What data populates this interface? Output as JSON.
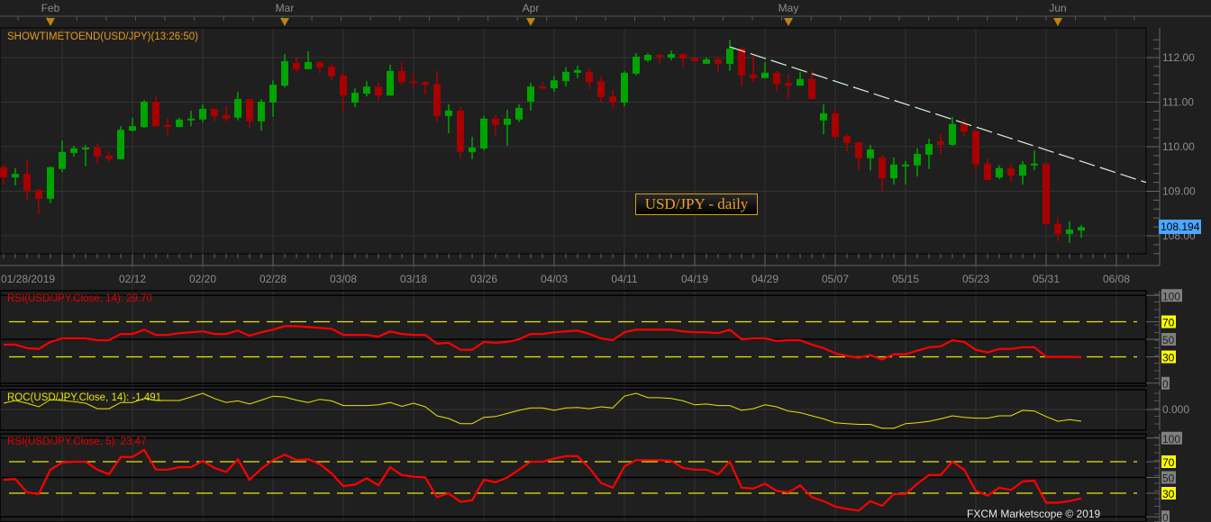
{
  "main": {
    "title": "SHOWTIMETOEND(USD/JPY)(13:26:50)",
    "legend_label": "USD/JPY - daily",
    "last_price": "108.194",
    "copyright": "FXCM Marketscope © 2019"
  },
  "colors": {
    "background": "#1f1f1f",
    "grid": "#333333",
    "bull": "#00a400",
    "bear": "#a80000",
    "title": "#e69a1c",
    "rsi": "#ff0000",
    "roc": "#e6e600",
    "level": "#e6e600",
    "trendline": "#d8f5d8",
    "last_price_bg": "#4da6ff"
  },
  "chart_data": {
    "type": "candlestick",
    "symbol": "USD/JPY",
    "month_markers": [
      "Feb",
      "Mar",
      "Apr",
      "May",
      "Jun"
    ],
    "x_tick_labels": [
      "01/28/2019",
      "02/12",
      "02/20",
      "02/28",
      "03/08",
      "03/18",
      "03/26",
      "04/03",
      "04/11",
      "04/19",
      "04/29",
      "05/07",
      "05/15",
      "05/23",
      "05/31",
      "06/08"
    ],
    "y_tick_labels": [
      "112.00",
      "111.00",
      "110.00",
      "109.00",
      "108.00"
    ],
    "ylim": [
      107.6,
      112.65
    ],
    "grid": true,
    "candles_columns": [
      "date",
      "open",
      "high",
      "low",
      "close"
    ],
    "candles": [
      [
        "01/28",
        109.54,
        109.58,
        109.15,
        109.31
      ],
      [
        "01/29",
        109.31,
        109.52,
        109.13,
        109.39
      ],
      [
        "01/30",
        109.39,
        109.72,
        108.81,
        109.01
      ],
      [
        "01/31",
        109.03,
        109.05,
        108.49,
        108.83
      ],
      [
        "02/01",
        108.83,
        109.56,
        108.73,
        109.54
      ],
      [
        "02/04",
        109.5,
        110.14,
        109.43,
        109.88
      ],
      [
        "02/05",
        109.86,
        110.02,
        109.78,
        109.96
      ],
      [
        "02/06",
        109.94,
        110.04,
        109.56,
        109.98
      ],
      [
        "02/07",
        109.98,
        110.08,
        109.62,
        109.78
      ],
      [
        "02/08",
        109.8,
        109.88,
        109.66,
        109.72
      ],
      [
        "02/11",
        109.72,
        110.46,
        109.72,
        110.38
      ],
      [
        "02/12",
        110.36,
        110.65,
        110.34,
        110.46
      ],
      [
        "02/13",
        110.44,
        111.05,
        110.42,
        111.01
      ],
      [
        "02/14",
        111.01,
        111.13,
        110.44,
        110.46
      ],
      [
        "02/15",
        110.49,
        110.65,
        110.26,
        110.44
      ],
      [
        "02/18",
        110.44,
        110.65,
        110.44,
        110.61
      ],
      [
        "02/19",
        110.59,
        110.81,
        110.46,
        110.63
      ],
      [
        "02/20",
        110.61,
        110.95,
        110.55,
        110.85
      ],
      [
        "02/21",
        110.85,
        110.85,
        110.57,
        110.69
      ],
      [
        "02/22",
        110.71,
        110.91,
        110.57,
        110.63
      ],
      [
        "02/25",
        110.65,
        111.23,
        110.59,
        111.07
      ],
      [
        "02/26",
        111.07,
        111.07,
        110.42,
        110.57
      ],
      [
        "02/27",
        110.57,
        111.07,
        110.36,
        111.01
      ],
      [
        "02/28",
        110.99,
        111.49,
        110.67,
        111.39
      ],
      [
        "03/01",
        111.37,
        112.08,
        111.33,
        111.92
      ],
      [
        "03/04",
        111.88,
        112.02,
        111.66,
        111.74
      ],
      [
        "03/05",
        111.74,
        112.14,
        111.74,
        111.9
      ],
      [
        "03/06",
        111.9,
        111.92,
        111.64,
        111.78
      ],
      [
        "03/07",
        111.8,
        111.86,
        111.49,
        111.58
      ],
      [
        "03/08",
        111.6,
        111.66,
        110.77,
        111.15
      ],
      [
        "03/11",
        110.99,
        111.31,
        110.89,
        111.21
      ],
      [
        "03/12",
        111.19,
        111.47,
        111.13,
        111.35
      ],
      [
        "03/13",
        111.35,
        111.45,
        111.03,
        111.15
      ],
      [
        "03/14",
        111.15,
        111.84,
        111.15,
        111.7
      ],
      [
        "03/15",
        111.7,
        111.9,
        111.39,
        111.45
      ],
      [
        "03/18",
        111.47,
        111.64,
        111.31,
        111.43
      ],
      [
        "03/19",
        111.45,
        111.47,
        111.17,
        111.39
      ],
      [
        "03/20",
        111.41,
        111.7,
        110.55,
        110.69
      ],
      [
        "03/21",
        110.69,
        110.95,
        110.3,
        110.81
      ],
      [
        "03/22",
        110.81,
        110.89,
        109.74,
        109.88
      ],
      [
        "03/25",
        109.88,
        110.22,
        109.72,
        109.98
      ],
      [
        "03/26",
        109.96,
        110.69,
        109.92,
        110.63
      ],
      [
        "03/27",
        110.63,
        110.71,
        110.24,
        110.49
      ],
      [
        "03/28",
        110.49,
        110.83,
        110.02,
        110.63
      ],
      [
        "03/29",
        110.61,
        110.95,
        110.55,
        110.87
      ],
      [
        "04/01",
        111.01,
        111.43,
        110.81,
        111.35
      ],
      [
        "04/02",
        111.35,
        111.45,
        111.27,
        111.31
      ],
      [
        "04/03",
        111.31,
        111.58,
        111.23,
        111.49
      ],
      [
        "04/04",
        111.47,
        111.78,
        111.35,
        111.68
      ],
      [
        "04/05",
        111.66,
        111.82,
        111.54,
        111.72
      ],
      [
        "04/08",
        111.68,
        111.76,
        111.29,
        111.45
      ],
      [
        "04/09",
        111.47,
        111.58,
        110.99,
        111.11
      ],
      [
        "04/10",
        111.13,
        111.27,
        110.85,
        110.99
      ],
      [
        "04/11",
        110.99,
        111.7,
        110.91,
        111.66
      ],
      [
        "04/12",
        111.64,
        112.1,
        111.6,
        112.02
      ],
      [
        "04/15",
        111.94,
        112.1,
        111.9,
        112.06
      ],
      [
        "04/16",
        112.06,
        112.08,
        111.86,
        112.02
      ],
      [
        "04/17",
        112.0,
        112.16,
        111.94,
        112.08
      ],
      [
        "04/18",
        112.08,
        112.1,
        111.78,
        111.98
      ],
      [
        "04/19",
        112.0,
        112.0,
        111.92,
        111.92
      ],
      [
        "04/22",
        111.86,
        112.0,
        111.86,
        111.96
      ],
      [
        "04/23",
        111.96,
        112.04,
        111.68,
        111.86
      ],
      [
        "04/24",
        111.86,
        112.4,
        111.7,
        112.2
      ],
      [
        "04/25",
        112.2,
        112.24,
        111.37,
        111.6
      ],
      [
        "04/26",
        111.62,
        112.04,
        111.45,
        111.54
      ],
      [
        "04/29",
        111.54,
        111.9,
        111.54,
        111.66
      ],
      [
        "04/30",
        111.66,
        111.7,
        111.25,
        111.41
      ],
      [
        "05/01",
        111.43,
        111.62,
        111.07,
        111.37
      ],
      [
        "05/02",
        111.37,
        111.68,
        111.37,
        111.52
      ],
      [
        "05/03",
        111.52,
        111.7,
        111.07,
        111.07
      ],
      [
        "05/06",
        110.59,
        110.95,
        110.28,
        110.75
      ],
      [
        "05/07",
        110.75,
        110.85,
        110.18,
        110.22
      ],
      [
        "05/08",
        110.24,
        110.28,
        109.9,
        110.08
      ],
      [
        "05/09",
        110.1,
        110.1,
        109.47,
        109.74
      ],
      [
        "05/10",
        109.74,
        110.04,
        109.47,
        109.94
      ],
      [
        "05/13",
        109.76,
        109.82,
        109.01,
        109.29
      ],
      [
        "05/14",
        109.29,
        109.76,
        109.15,
        109.6
      ],
      [
        "05/15",
        109.58,
        109.68,
        109.15,
        109.6
      ],
      [
        "05/16",
        109.58,
        109.96,
        109.33,
        109.84
      ],
      [
        "05/17",
        109.82,
        110.18,
        109.5,
        110.06
      ],
      [
        "05/20",
        110.12,
        110.3,
        109.82,
        110.04
      ],
      [
        "05/21",
        110.04,
        110.67,
        110.02,
        110.51
      ],
      [
        "05/22",
        110.51,
        110.63,
        110.24,
        110.34
      ],
      [
        "05/23",
        110.36,
        110.36,
        109.45,
        109.6
      ],
      [
        "05/24",
        109.62,
        109.74,
        109.25,
        109.25
      ],
      [
        "05/27",
        109.31,
        109.58,
        109.27,
        109.52
      ],
      [
        "05/28",
        109.52,
        109.62,
        109.21,
        109.35
      ],
      [
        "05/29",
        109.35,
        109.68,
        109.15,
        109.6
      ],
      [
        "05/30",
        109.58,
        109.92,
        109.47,
        109.62
      ],
      [
        "05/31",
        109.62,
        109.62,
        108.26,
        108.26
      ],
      [
        "06/03",
        108.26,
        108.42,
        107.88,
        108.04
      ],
      [
        "06/04",
        108.04,
        108.32,
        107.84,
        108.14
      ],
      [
        "06/05",
        108.12,
        108.24,
        107.96,
        108.194
      ]
    ],
    "trendline": [
      {
        "date": "04/24",
        "price": 112.24
      },
      {
        "date": "05/29",
        "price": 110.1
      }
    ],
    "indicators": [
      {
        "title": "RSI(USD/JPY.Close, 14): 29.70",
        "levels": [
          70,
          30
        ],
        "axis_labels": [
          "100",
          "70",
          "50",
          "30",
          "0"
        ],
        "ylim": [
          0,
          100
        ],
        "values": [
          44,
          44,
          40,
          39,
          47,
          51,
          51,
          51,
          49,
          49,
          56,
          56,
          61,
          55,
          55,
          57,
          58,
          59,
          56,
          56,
          60,
          54,
          58,
          61,
          65,
          65,
          64,
          63,
          62,
          55,
          55,
          55,
          53,
          59,
          56,
          55,
          55,
          45,
          46,
          38,
          38,
          47,
          46,
          47,
          50,
          56,
          56,
          58,
          59,
          60,
          56,
          51,
          49,
          58,
          61,
          61,
          61,
          61,
          59,
          58,
          58,
          57,
          61,
          50,
          51,
          51,
          48,
          49,
          49,
          44,
          40,
          34,
          31,
          29,
          32,
          27,
          33,
          33,
          37,
          41,
          42,
          49,
          47,
          38,
          35,
          39,
          39,
          41,
          41,
          30,
          30,
          30,
          29.7
        ]
      },
      {
        "title": "ROC(USD/JPY.Close, 14): -1.491",
        "levels": [],
        "axis_labels": [
          "0.000"
        ],
        "values": [
          0.8,
          1.15,
          0.8,
          0.35,
          1.26,
          1.15,
          1.0,
          0.8,
          0.1,
          0.1,
          0.9,
          0.9,
          1.4,
          1.15,
          1.15,
          1.15,
          1.6,
          2.07,
          1.4,
          0.9,
          1.1,
          0.7,
          1.2,
          1.7,
          1.6,
          1.2,
          0.9,
          1.3,
          1.1,
          0.5,
          0.5,
          0.5,
          0.6,
          0.9,
          0.4,
          0.8,
          0.35,
          -0.8,
          -1.15,
          -1.8,
          -1.8,
          -1.0,
          -0.9,
          -0.5,
          -0.1,
          0.2,
          0.2,
          -0.1,
          0.2,
          0.25,
          0.1,
          0.35,
          0.2,
          1.7,
          2.07,
          1.5,
          1.5,
          1.4,
          1.1,
          0.6,
          0.7,
          0.5,
          0.5,
          -0.1,
          0.1,
          0.6,
          0.35,
          -0.2,
          -0.4,
          -0.8,
          -1.2,
          -1.7,
          -1.8,
          -1.9,
          -1.9,
          -2.4,
          -2.4,
          -1.8,
          -1.7,
          -1.5,
          -1.2,
          -0.8,
          -1.0,
          -1.1,
          -1.1,
          -0.8,
          -0.8,
          -0.1,
          -0.2,
          -0.9,
          -1.5,
          -1.3,
          -1.491
        ]
      },
      {
        "title": "RSI(USD/JPY.Close, 5): 23.47",
        "levels": [
          70,
          30
        ],
        "axis_labels": [
          "100",
          "70",
          "50",
          "30",
          "0"
        ],
        "ylim": [
          0,
          100
        ],
        "values": [
          47,
          48,
          31,
          29,
          60,
          69,
          70,
          70,
          60,
          54,
          76,
          76,
          85,
          60,
          60,
          63,
          63,
          71,
          62,
          57,
          73,
          47,
          61,
          72,
          79,
          72,
          73,
          67,
          55,
          39,
          41,
          49,
          40,
          63,
          53,
          51,
          50,
          25,
          30,
          19,
          21,
          47,
          44,
          50,
          60,
          70,
          70,
          74,
          77,
          77,
          62,
          43,
          37,
          64,
          72,
          72,
          72,
          71,
          62,
          60,
          60,
          54,
          70,
          37,
          36,
          42,
          33,
          31,
          40,
          25,
          20,
          13,
          10,
          8,
          20,
          14,
          29,
          29,
          42,
          53,
          53,
          70,
          60,
          33,
          27,
          37,
          34,
          45,
          46,
          18,
          18,
          20,
          23.47
        ]
      }
    ]
  }
}
